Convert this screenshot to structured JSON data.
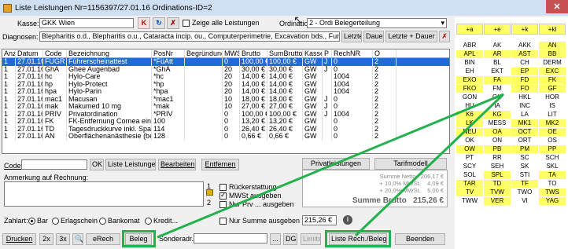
{
  "window": {
    "title": "Liste Leistungen Nr=1156397/27.01.16  Ordinations-ID=2",
    "close_label": "✕"
  },
  "header": {
    "kasse_label": "Kasse:",
    "kasse_value": "GKK Wien",
    "k_button": "K",
    "zeige_alle_label": "Zeige alle Leistungen",
    "ordination_label": "Ordination:",
    "ordination_value": "2 - Ordi Belegerteilung",
    "diagnosen_label": "Diagnosen:",
    "diagnosen_value": "Blepharitis o.d., Blepharitis o.u., Cataracta incip. ou., Computerperimetrie, Excavation bds., Fundus bds. oB",
    "letzte_button": "Letzte",
    "dauer_button": "Dauer",
    "letzte_dauer_button": "Letzte + Dauer"
  },
  "table": {
    "columns": [
      "Anz",
      "Datum",
      "Code",
      "Bezeichnung",
      "PosNr",
      "Begründung",
      "MWSt",
      "Brutto",
      "SumBrutto",
      "Kasse",
      "P",
      "RechNR",
      "O"
    ],
    "rows": [
      [
        "1",
        "27.01.16",
        "FUGR",
        "Führerscheinattest",
        "*FüAtt",
        "",
        "0",
        "100,00 €",
        "100,00 €",
        "GW",
        "J",
        "0",
        "2"
      ],
      [
        "1",
        "27.01.16",
        "GhA",
        "Ghee Augenbad",
        "*GhA",
        "",
        "20",
        "30,00 €",
        "30,00 €",
        "GW",
        "J",
        "0",
        "2"
      ],
      [
        "1",
        "27.01.16",
        "hc",
        "Hylo-Care",
        "*hc",
        "",
        "20",
        "14,00 €",
        "14,00 €",
        "GW",
        "",
        "1004",
        "2"
      ],
      [
        "1",
        "27.01.16",
        "hp",
        "Hylo-Protect",
        "*hp",
        "",
        "20",
        "14,00 €",
        "14,00 €",
        "GW",
        "",
        "1004",
        "2"
      ],
      [
        "1",
        "27.01.16",
        "hpa",
        "Hylo-Parin",
        "*hpa",
        "",
        "20",
        "14,00 €",
        "14,00 €",
        "GW",
        "",
        "1004",
        "2"
      ],
      [
        "1",
        "27.01.16",
        "mac1",
        "Macusan",
        "*mac1",
        "",
        "10",
        "18,00 €",
        "18,00 €",
        "GW",
        "J",
        "0",
        "2"
      ],
      [
        "1",
        "27.01.16",
        "mak",
        "Makumed 10 mg",
        "*mak",
        "",
        "10",
        "27,00 €",
        "27,00 €",
        "GW",
        "J",
        "0",
        "2"
      ],
      [
        "1",
        "27.01.16",
        "PRIV",
        "Privatordination",
        "*PRIV",
        "",
        "0",
        "100,00 €",
        "100,00 €",
        "GW",
        "J",
        "1004",
        "2"
      ],
      [
        "1",
        "27.01.16",
        "FK",
        "FK-Entfernung Cornea einschl.Anä",
        "100",
        "",
        "0",
        "13,20 €",
        "13,20 €",
        "GW",
        "",
        "0",
        "2"
      ],
      [
        "1",
        "27.01.16",
        "TD",
        "Tagesdruckkurve inkl. Spaltlampe",
        "114",
        "",
        "0",
        "26,40 €",
        "26,40 €",
        "GW",
        "",
        "0",
        "2"
      ],
      [
        "1",
        "27.01.16",
        "AN",
        "Oberflächenanästhesie (bei.Metho",
        "128",
        "",
        "0",
        "0,66 €",
        "0,66 €",
        "GW",
        "",
        "0",
        "2"
      ]
    ]
  },
  "code_row": {
    "code_label": "Code:",
    "ok_button": "OK",
    "liste_button": "Liste Leistungen",
    "bearbeiten_button": "Bearbeiten",
    "entfernen_button": "Entfernen",
    "privat_button": "Privatleistungen",
    "tarif_button": "Tarifmodell"
  },
  "anmerkung": {
    "label": "Anmerkung auf Rechnung:",
    "n1": "1",
    "n2": "2",
    "rueck_label": "Rückerstattung",
    "mwst_label": "MWSt ausgeben",
    "nurprv_label": "Nur Prv ... ausgeben",
    "nursumme_label": "Nur Summe ausgeben"
  },
  "sums": {
    "netto_label": "Summe Netto",
    "netto_value": "206,17 €",
    "mwst10_label": "+ 10,0% MWSt.",
    "mwst10_value": "4,09 €",
    "mwst20_label": "+ 20,0% MWSt.",
    "mwst20_value": "5,00 €",
    "brutto_label": "Summe Brutto",
    "brutto_value": "215,26 €",
    "total_field": "215,26 €"
  },
  "zahlart": {
    "label": "Zahlart:",
    "bar": "Bar",
    "erlag": "Erlagschein",
    "bankomat": "Bankomat",
    "kredit": "Kredit..."
  },
  "bottom": {
    "drucken": "Drucken",
    "x2": "2x",
    "x3": "3x",
    "erech": "eRech",
    "beleg": "Beleg",
    "sonderadr_label": "Sonderadr.:",
    "dots": "...",
    "dg": "DG",
    "limits": "Limits",
    "liste_rech": "Liste Rech./Belege",
    "beenden": "Beenden"
  },
  "right_panel": {
    "header": [
      "+a",
      "+e",
      "+k",
      "+kl"
    ],
    "cells": [
      [
        "ABR",
        "w"
      ],
      [
        "AK",
        "w"
      ],
      [
        "AKK",
        "w"
      ],
      [
        "AN",
        "y"
      ],
      [
        "APL",
        "y"
      ],
      [
        "AR",
        "y"
      ],
      [
        "AST",
        "y"
      ],
      [
        "BB",
        "y"
      ],
      [
        "BIN",
        "w"
      ],
      [
        "BL",
        "w"
      ],
      [
        "CH",
        "w"
      ],
      [
        "DERM",
        "w"
      ],
      [
        "EH",
        "w"
      ],
      [
        "EKT",
        "w"
      ],
      [
        "EP",
        "y"
      ],
      [
        "EXC",
        "y"
      ],
      [
        "EXO",
        "y"
      ],
      [
        "FA",
        "y"
      ],
      [
        "FD",
        "y"
      ],
      [
        "FK",
        "y"
      ],
      [
        "FKO",
        "y"
      ],
      [
        "FM",
        "w"
      ],
      [
        "FO",
        "y"
      ],
      [
        "GF",
        "y"
      ],
      [
        "GON",
        "w"
      ],
      [
        "GU",
        "w"
      ],
      [
        "HKL",
        "w"
      ],
      [
        "HOR",
        "w"
      ],
      [
        "HU",
        "w"
      ],
      [
        "IA",
        "w"
      ],
      [
        "INC",
        "w"
      ],
      [
        "IS",
        "w"
      ],
      [
        "K6",
        "y"
      ],
      [
        "KG",
        "y"
      ],
      [
        "LA",
        "w"
      ],
      [
        "LIT",
        "w"
      ],
      [
        "LK",
        "y"
      ],
      [
        "MESS",
        "w"
      ],
      [
        "MK1",
        "y"
      ],
      [
        "MK2",
        "y"
      ],
      [
        "NEU",
        "y"
      ],
      [
        "OA",
        "y"
      ],
      [
        "OCT",
        "y"
      ],
      [
        "OE",
        "y"
      ],
      [
        "OK",
        "w"
      ],
      [
        "ON",
        "w"
      ],
      [
        "ORT",
        "w"
      ],
      [
        "OS",
        "w"
      ],
      [
        "OW",
        "y"
      ],
      [
        "PB",
        "y"
      ],
      [
        "PM",
        "y"
      ],
      [
        "PP",
        "y"
      ],
      [
        "PT",
        "w"
      ],
      [
        "RR",
        "w"
      ],
      [
        "SC",
        "w"
      ],
      [
        "SCH",
        "w"
      ],
      [
        "SCY",
        "w"
      ],
      [
        "SEH",
        "w"
      ],
      [
        "SK",
        "w"
      ],
      [
        "SKL",
        "w"
      ],
      [
        "SOL",
        "w"
      ],
      [
        "SPL",
        "y"
      ],
      [
        "STI",
        "w"
      ],
      [
        "TA",
        "y"
      ],
      [
        "TAR",
        "y"
      ],
      [
        "TD",
        "y"
      ],
      [
        "TF",
        "y"
      ],
      [
        "TO",
        "w"
      ],
      [
        "TV",
        "y"
      ],
      [
        "TVW",
        "y"
      ],
      [
        "TWO",
        "w"
      ],
      [
        "TWS",
        "y"
      ],
      [
        "TWW",
        "w"
      ],
      [
        "VER",
        "y"
      ],
      [
        "VI",
        "w"
      ],
      [
        "YAG",
        "y"
      ]
    ]
  },
  "colors": {
    "highlight_green": "#22b14c",
    "selection_blue": "#1a6fd6",
    "yellow": "#ffff66"
  }
}
